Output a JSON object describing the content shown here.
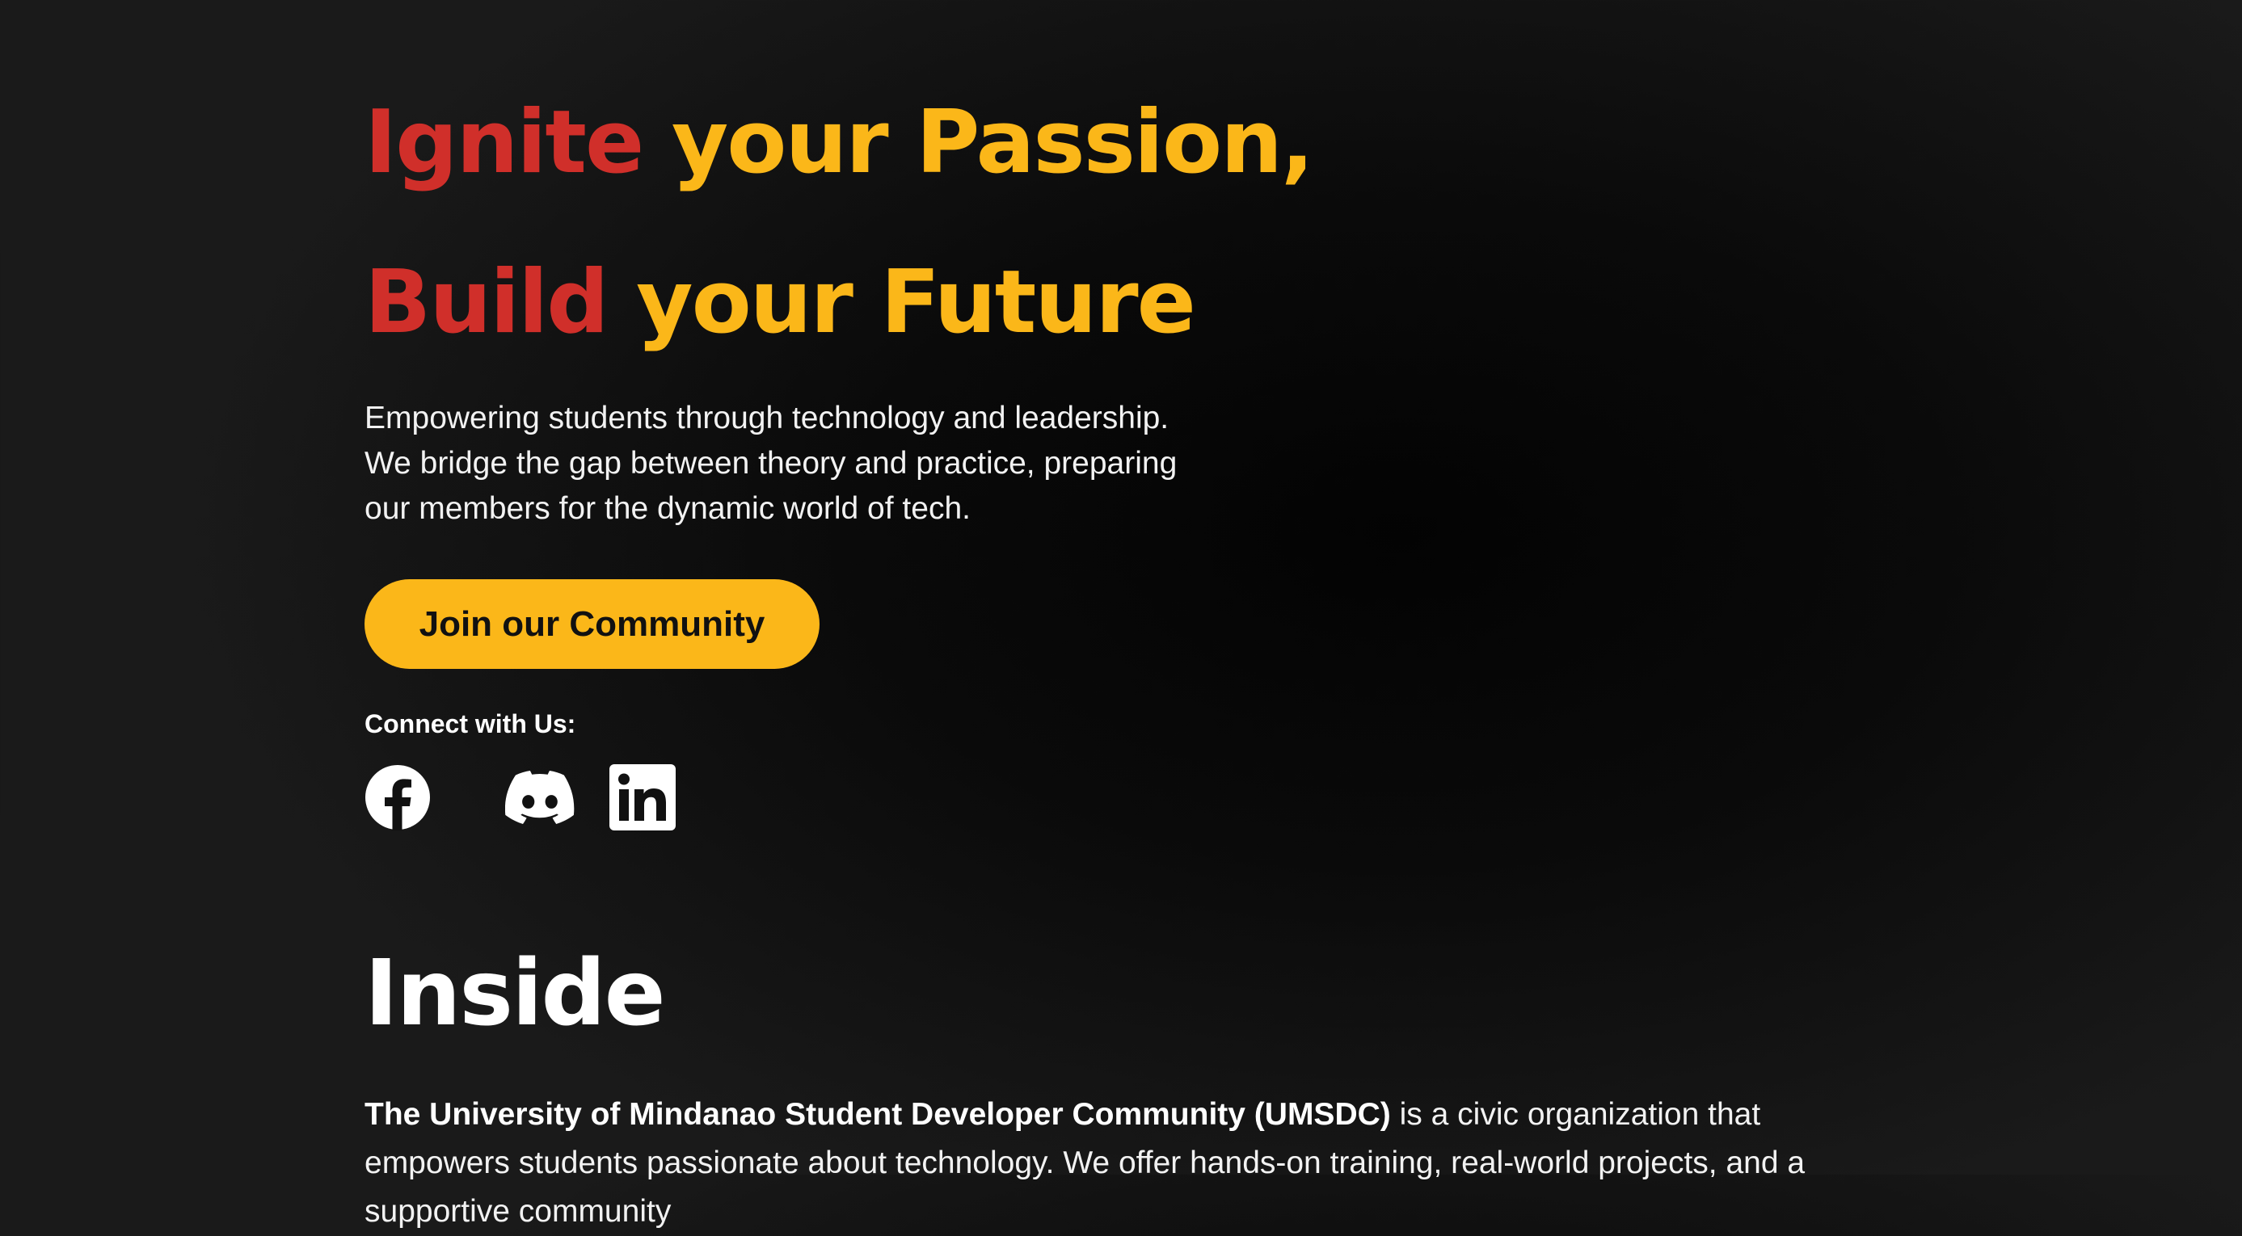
{
  "hero": {
    "line1": {
      "accent": "Ignite",
      "rest": "your Passion,"
    },
    "line2": {
      "accent": "Build",
      "rest": "your Future"
    },
    "description": "Empowering students through technology and leadership. We bridge the gap between theory and practice, preparing our members for the dynamic world of tech.",
    "cta_label": "Join our Community",
    "connect_label": "Connect with Us:"
  },
  "social_icons": [
    "facebook-icon",
    "discord-icon",
    "linkedin-icon"
  ],
  "inside": {
    "title": "Inside",
    "org_name": "The University of Mindanao Student Developer Community (UMSDC)",
    "text": "is a civic organization that empowers students passionate about technology. We offer hands-on training, real-world projects, and a supportive community"
  },
  "colors": {
    "accent_red": "#d02f2a",
    "accent_yellow": "#fbb719",
    "background": "#111111"
  }
}
